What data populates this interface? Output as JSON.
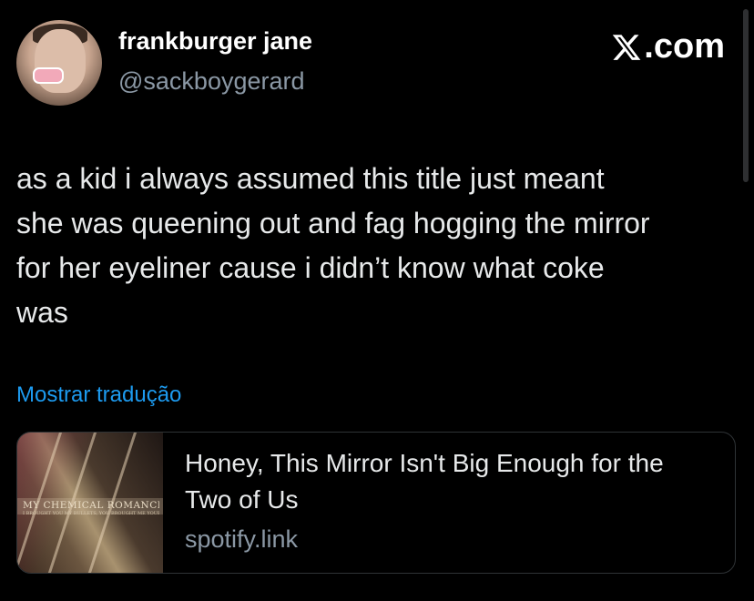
{
  "author": {
    "display_name": "frankburger jane",
    "handle": "@sackboygerard"
  },
  "source": {
    "label": ".com",
    "icon": "x-logo-icon"
  },
  "tweet": {
    "text": "as a kid i always assumed this title just meant\nshe was queening out and fag hogging the mirror\nfor her eyeliner cause i didn’t know what coke\nwas",
    "translate_label": "Mostrar tradução"
  },
  "link_card": {
    "album_art_text": "MY CHEMICAL ROMANCE",
    "album_art_subtext": "I BROUGHT YOU MY BULLETS, YOU BROUGHT ME YOUR LOVE",
    "title": "Honey, This Mirror Isn't Big Enough for the Two of Us",
    "domain": "spotify.link"
  }
}
